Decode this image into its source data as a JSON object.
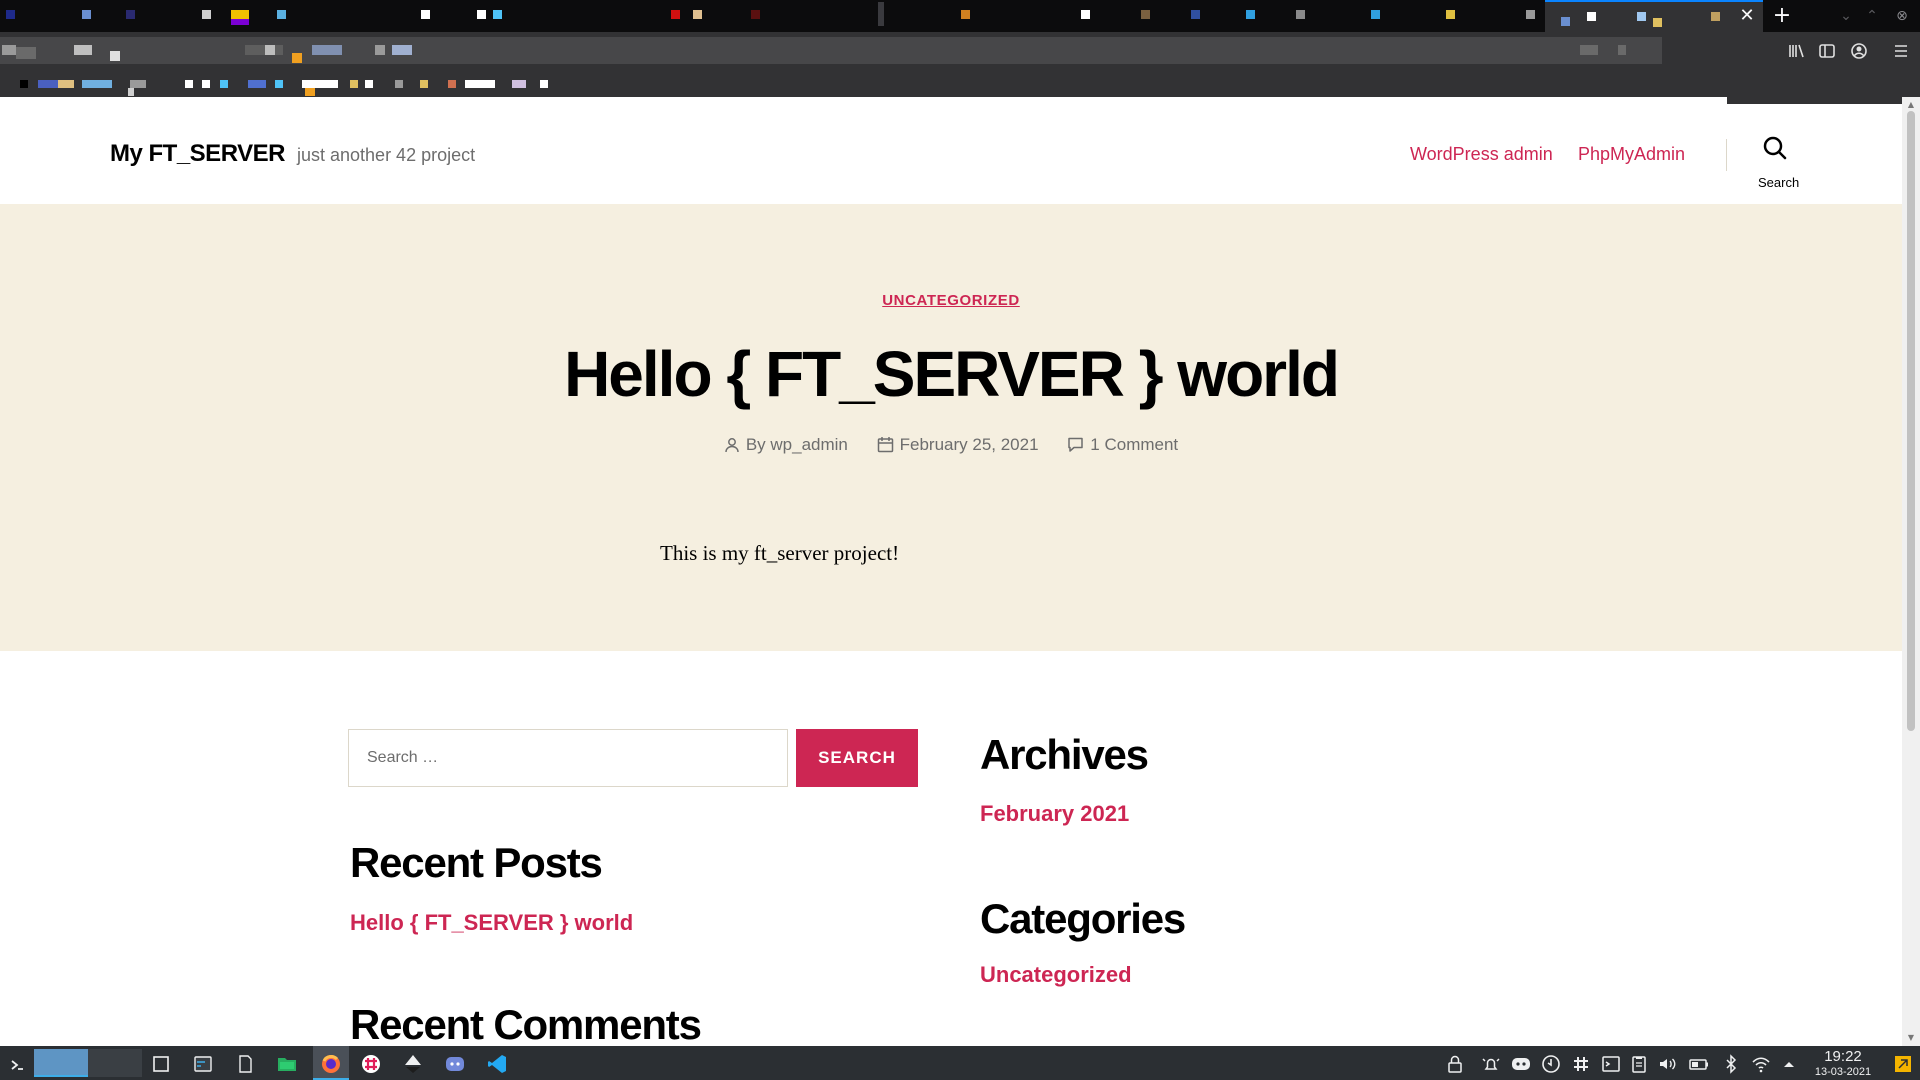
{
  "site": {
    "title": "My FT_SERVER",
    "description": "just another 42 project"
  },
  "nav": {
    "links": [
      "WordPress admin",
      "PhpMyAdmin"
    ],
    "search_label": "Search"
  },
  "post": {
    "category": "UNCATEGORIZED",
    "title": "Hello { FT_SERVER } world",
    "author": "By wp_admin",
    "date": "February 25, 2021",
    "comments": "1 Comment",
    "content": "This is my ft_server project!"
  },
  "widgets": {
    "search": {
      "placeholder": "Search …",
      "button": "SEARCH"
    },
    "recent_posts": {
      "title": "Recent Posts",
      "items": [
        "Hello { FT_SERVER } world"
      ]
    },
    "recent_comments": {
      "title": "Recent Comments"
    },
    "archives": {
      "title": "Archives",
      "items": [
        "February 2021"
      ]
    },
    "categories": {
      "title": "Categories",
      "items": [
        "Uncategorized"
      ]
    }
  },
  "browser": {
    "tab_close": "✕",
    "new_tab": "+"
  },
  "taskbar": {
    "time": "19:22",
    "date": "13-03-2021"
  },
  "colors": {
    "accent": "#cd2653",
    "hero_bg": "#f5efe0",
    "text": "#000000",
    "meta_text": "#6d6d6d",
    "taskbar_bg": "#2b2f33",
    "browser_bg": "#0c0c0d"
  }
}
